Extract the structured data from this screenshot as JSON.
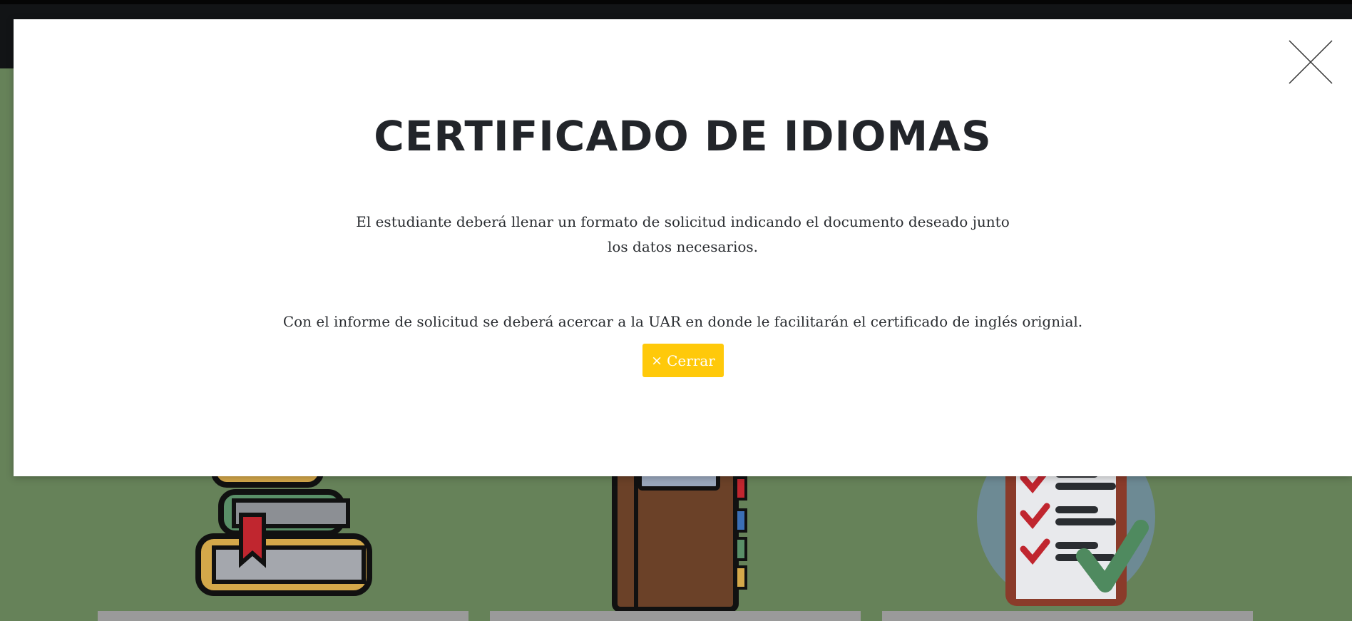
{
  "colors": {
    "background": "#668259",
    "topbar": "#121416",
    "modal_bg": "#ffffff",
    "button": "#ffc90a"
  },
  "background_cards": [
    {
      "icon": "books-stack-icon"
    },
    {
      "icon": "notebook-icon"
    },
    {
      "icon": "checklist-icon"
    }
  ],
  "modal": {
    "close_icon": "close-icon",
    "title": "CERTIFICADO DE IDIOMAS",
    "paragraph_1": "El estudiante deberá llenar un formato de solicitud indicando el documento deseado junto los datos necesarios.",
    "paragraph_2": "Con el informe de solicitud se deberá acercar a la UAR en donde le facilitarán el certificado de inglés orignial.",
    "button": {
      "icon": "×",
      "label": "Cerrar"
    }
  }
}
